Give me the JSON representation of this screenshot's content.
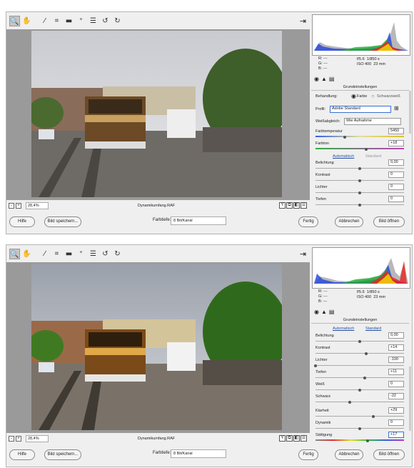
{
  "toolbar_icons": [
    "zoom-icon",
    "hand-icon",
    "white-balance-icon",
    "crop-icon",
    "straighten-icon",
    "spot-removal-icon",
    "list-icon",
    "rotate-ccw-icon",
    "rotate-cw-icon"
  ],
  "glyphs": {
    "zoom": "🔍",
    "hand": "✋",
    "wb": "⁄",
    "crop": "⌗",
    "straighten": "▬",
    "spot": "⁺",
    "list": "☰",
    "rotl": "↺",
    "rotr": "↻",
    "exp": "⇥"
  },
  "zoom": {
    "minus": "-",
    "plus": "+",
    "value": "28,4%",
    "chevron": "⌵"
  },
  "filename": "Dynamikumfang.RAF",
  "view_buttons": [
    "Y",
    "⧉",
    "◧",
    "☰"
  ],
  "buttons": {
    "help": "Hilfe",
    "save": "Bild speichern...",
    "done": "Fertig",
    "cancel": "Abbrechen",
    "open": "Bild öffnen"
  },
  "depth": {
    "label": "Farbtiefe:",
    "value": "8 Bit/Kanal"
  },
  "info": {
    "r": "R:",
    "g": "G:",
    "b": "B:",
    "dash": "---",
    "aperture": "f/5.6",
    "shutter": "1/850 s",
    "iso": "ISO 400",
    "focal": "23 mm"
  },
  "panel_tabs": [
    "◉",
    "▲",
    "▤"
  ],
  "panel_title": "Grundeinstellungen",
  "s1": {
    "treatment_label": "Behandlung:",
    "color": "Farbe",
    "bw": "Schwarzweiß",
    "profile_label": "Profil:",
    "profile": "Adobe Standard",
    "wb_label": "Weißabgleich:",
    "wb": "Wie Aufnahme",
    "temp_label": "Farbtemperatur",
    "temp": "5450",
    "tint_label": "Farbton",
    "tint": "+18",
    "auto": "Automatisch",
    "standard": "Standard",
    "sliders": [
      {
        "label": "Belichtung",
        "value": "0,00",
        "pos": 0.5
      },
      {
        "label": "Kontrast",
        "value": "0",
        "pos": 0.5
      },
      {
        "label": "Lichter",
        "value": "0",
        "pos": 0.5
      },
      {
        "label": "Tiefen",
        "value": "0",
        "pos": 0.5
      }
    ],
    "temp_pos": 0.33,
    "tint_pos": 0.57
  },
  "s2": {
    "auto": "Automatisch",
    "standard": "Standard",
    "sliders": [
      {
        "label": "Belichtung",
        "value": "0,00",
        "pos": 0.5
      },
      {
        "label": "Kontrast",
        "value": "+14",
        "pos": 0.57
      },
      {
        "label": "Lichter",
        "value": "-100",
        "pos": 0.0
      },
      {
        "label": "Tiefen",
        "value": "+11",
        "pos": 0.56
      },
      {
        "label": "Weiß",
        "value": "0",
        "pos": 0.5
      },
      {
        "label": "Schwarz",
        "value": "-22",
        "pos": 0.39
      }
    ],
    "sliders2": [
      {
        "label": "Klarheit",
        "value": "+29",
        "pos": 0.65
      },
      {
        "label": "Dynamik",
        "value": "0",
        "pos": 0.5
      },
      {
        "label": "Sättigung",
        "value": "+17",
        "pos": 0.59,
        "sat": true
      }
    ]
  }
}
